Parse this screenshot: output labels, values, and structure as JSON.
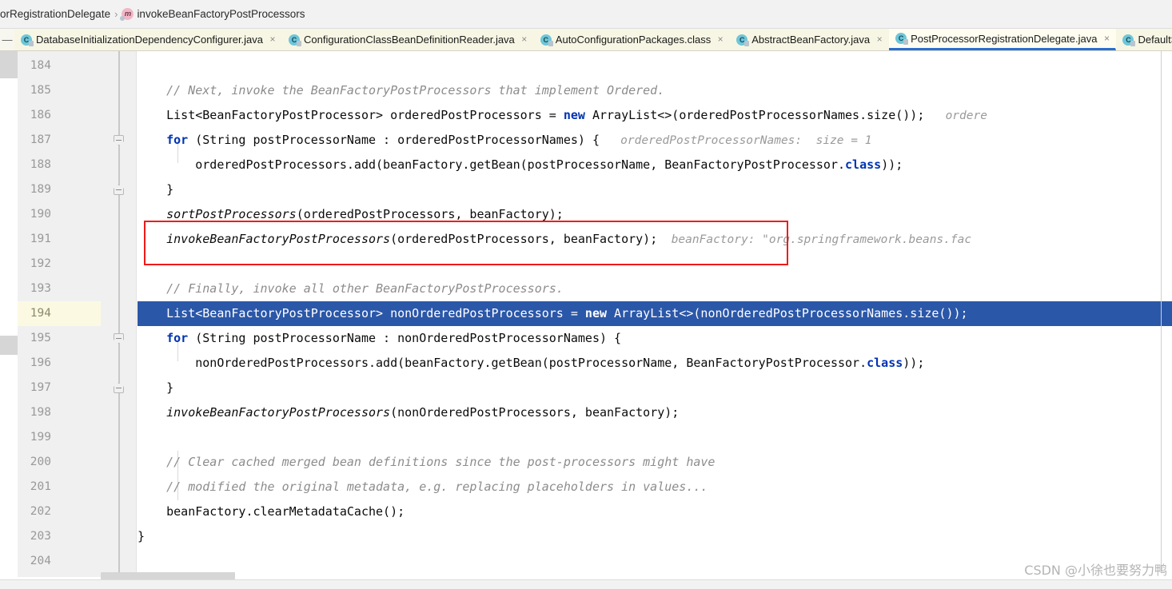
{
  "breadcrumb": {
    "items": [
      {
        "label": "orRegistrationDelegate",
        "icon": null
      },
      {
        "label": "invokeBeanFactoryPostProcessors",
        "icon": "method-icon"
      }
    ],
    "separator": "›"
  },
  "tabs": {
    "scroll_left_label": "—",
    "items": [
      {
        "label": "DatabaseInitializationDependencyConfigurer.java",
        "icon": "class-icon",
        "active": false,
        "close": "×"
      },
      {
        "label": "ConfigurationClassBeanDefinitionReader.java",
        "icon": "class-icon",
        "active": false,
        "close": "×"
      },
      {
        "label": "AutoConfigurationPackages.class",
        "icon": "class-icon",
        "active": false,
        "close": "×"
      },
      {
        "label": "AbstractBeanFactory.java",
        "icon": "class-icon",
        "active": false,
        "close": "×"
      },
      {
        "label": "PostProcessorRegistrationDelegate.java",
        "icon": "class-icon",
        "active": true,
        "close": "×"
      },
      {
        "label": "DefaultSi",
        "icon": "class-icon",
        "active": false,
        "close": ""
      }
    ],
    "active_index": 4,
    "active_underline_color": "#2b6fd0"
  },
  "editor": {
    "first_line_number": 184,
    "current_line": 194,
    "line_numbers": [
      184,
      185,
      186,
      187,
      188,
      189,
      190,
      191,
      192,
      193,
      194,
      195,
      196,
      197,
      198,
      199,
      200,
      201,
      202,
      203,
      204
    ],
    "fold_markers": [
      {
        "line": 187,
        "type": "down"
      },
      {
        "line": 189,
        "type": "up"
      },
      {
        "line": 195,
        "type": "down"
      },
      {
        "line": 197,
        "type": "up"
      }
    ],
    "highlight_color": "#2b57a8",
    "current_gutter_color": "#fcf9e3",
    "annotation_color": "#f01a1a",
    "lines": [
      {
        "n": 184,
        "tokens": []
      },
      {
        "n": 185,
        "tokens": [
          {
            "t": "indent",
            "s": "    "
          },
          {
            "t": "cmt",
            "s": "// Next, invoke the BeanFactoryPostProcessors that implement Ordered."
          }
        ]
      },
      {
        "n": 186,
        "tokens": [
          {
            "t": "indent",
            "s": "    "
          },
          {
            "t": "p",
            "s": "List<BeanFactoryPostProcessor> orderedPostProcessors = "
          },
          {
            "t": "kw",
            "s": "new"
          },
          {
            "t": "p",
            "s": " ArrayList<>(orderedPostProcessorNames.size());"
          },
          {
            "t": "hint",
            "s": "   ordere"
          }
        ]
      },
      {
        "n": 187,
        "tokens": [
          {
            "t": "indent",
            "s": "    "
          },
          {
            "t": "kw",
            "s": "for"
          },
          {
            "t": "p",
            "s": " (String postProcessorName : orderedPostProcessorNames) {"
          },
          {
            "t": "hint",
            "s": "   orderedPostProcessorNames:  size = 1"
          }
        ]
      },
      {
        "n": 188,
        "tokens": [
          {
            "t": "indent",
            "s": "        "
          },
          {
            "t": "p",
            "s": "orderedPostProcessors.add(beanFactory.getBean(postProcessorName, BeanFactoryPostProcessor."
          },
          {
            "t": "kw",
            "s": "class"
          },
          {
            "t": "p",
            "s": "));"
          }
        ]
      },
      {
        "n": 189,
        "tokens": [
          {
            "t": "indent",
            "s": "    "
          },
          {
            "t": "p",
            "s": "}"
          }
        ]
      },
      {
        "n": 190,
        "tokens": [
          {
            "t": "indent",
            "s": "    "
          },
          {
            "t": "mth",
            "s": "sortPostProcessors"
          },
          {
            "t": "p",
            "s": "(orderedPostProcessors, beanFactory);"
          }
        ]
      },
      {
        "n": 191,
        "tokens": [
          {
            "t": "indent",
            "s": "    "
          },
          {
            "t": "mth",
            "s": "invokeBeanFactoryPostProcessors"
          },
          {
            "t": "p",
            "s": "(orderedPostProcessors, beanFactory);"
          },
          {
            "t": "hint",
            "s": "  beanFactory: \"org.springframework.beans.fac"
          }
        ]
      },
      {
        "n": 192,
        "tokens": []
      },
      {
        "n": 193,
        "tokens": [
          {
            "t": "indent",
            "s": "    "
          },
          {
            "t": "cmt",
            "s": "// Finally, invoke all other BeanFactoryPostProcessors."
          }
        ]
      },
      {
        "n": 194,
        "tokens": [
          {
            "t": "indent",
            "s": "    "
          },
          {
            "t": "p",
            "s": "List<BeanFactoryPostProcessor> nonOrderedPostProcessors = "
          },
          {
            "t": "kw",
            "s": "new"
          },
          {
            "t": "p",
            "s": " ArrayList<>(nonOrderedPostProcessorNames.size());"
          }
        ]
      },
      {
        "n": 195,
        "tokens": [
          {
            "t": "indent",
            "s": "    "
          },
          {
            "t": "kw",
            "s": "for"
          },
          {
            "t": "p",
            "s": " (String postProcessorName : nonOrderedPostProcessorNames) {"
          }
        ]
      },
      {
        "n": 196,
        "tokens": [
          {
            "t": "indent",
            "s": "        "
          },
          {
            "t": "p",
            "s": "nonOrderedPostProcessors.add(beanFactory.getBean(postProcessorName, BeanFactoryPostProcessor."
          },
          {
            "t": "kw",
            "s": "class"
          },
          {
            "t": "p",
            "s": "));"
          }
        ]
      },
      {
        "n": 197,
        "tokens": [
          {
            "t": "indent",
            "s": "    "
          },
          {
            "t": "p",
            "s": "}"
          }
        ]
      },
      {
        "n": 198,
        "tokens": [
          {
            "t": "indent",
            "s": "    "
          },
          {
            "t": "mth",
            "s": "invokeBeanFactoryPostProcessors"
          },
          {
            "t": "p",
            "s": "(nonOrderedPostProcessors, beanFactory);"
          }
        ]
      },
      {
        "n": 199,
        "tokens": []
      },
      {
        "n": 200,
        "tokens": [
          {
            "t": "indent",
            "s": "    "
          },
          {
            "t": "cmt",
            "s": "// Clear cached merged bean definitions since the post-processors might have"
          }
        ]
      },
      {
        "n": 201,
        "tokens": [
          {
            "t": "indent",
            "s": "    "
          },
          {
            "t": "cmt",
            "s": "// modified the original metadata, e.g. replacing placeholders in values..."
          }
        ]
      },
      {
        "n": 202,
        "tokens": [
          {
            "t": "indent",
            "s": "    "
          },
          {
            "t": "p",
            "s": "beanFactory.clearMetadataCache();"
          }
        ]
      },
      {
        "n": 203,
        "tokens": [
          {
            "t": "p",
            "s": "}"
          }
        ]
      },
      {
        "n": 204,
        "tokens": []
      }
    ]
  },
  "watermark": {
    "text": "CSDN @小徐也要努力鸭"
  }
}
